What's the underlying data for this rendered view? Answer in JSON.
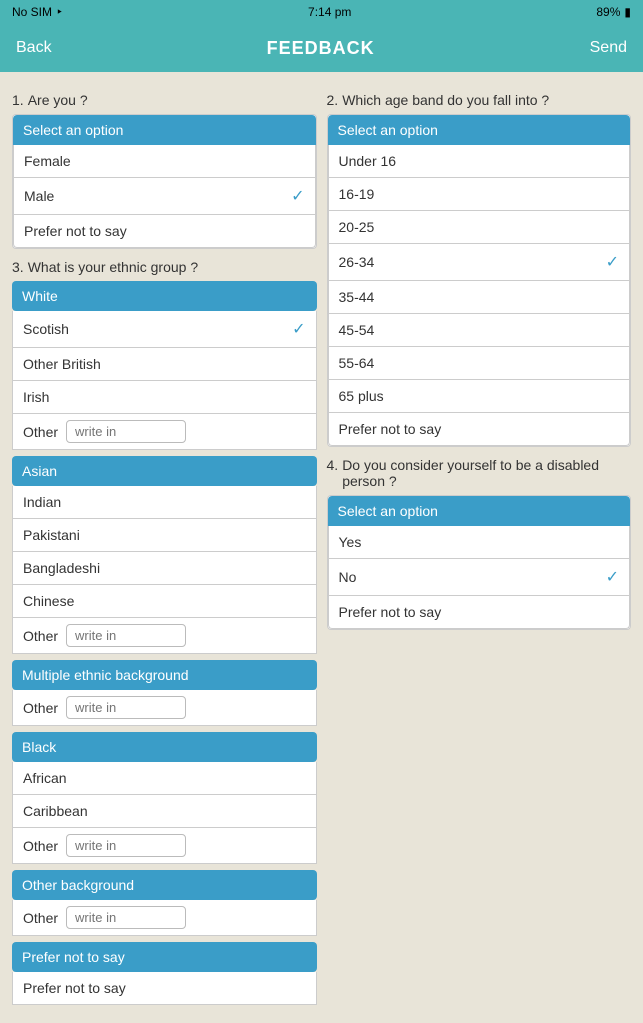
{
  "statusBar": {
    "carrier": "No SIM",
    "time": "7:14 pm",
    "battery": "89%"
  },
  "header": {
    "back": "Back",
    "title": "FEEDBACK",
    "send": "Send"
  },
  "q1": {
    "number": "1.",
    "label": "Are you ?",
    "selectLabel": "Select an option",
    "options": [
      {
        "text": "Female",
        "checked": false
      },
      {
        "text": "Male",
        "checked": true
      },
      {
        "text": "Prefer not to say",
        "checked": false
      }
    ]
  },
  "q2": {
    "number": "2.",
    "label": "Which age band do you fall into ?",
    "selectLabel": "Select an option",
    "options": [
      {
        "text": "Under 16",
        "checked": false
      },
      {
        "text": "16-19",
        "checked": false
      },
      {
        "text": "20-25",
        "checked": false
      },
      {
        "text": "26-34",
        "checked": true
      },
      {
        "text": "35-44",
        "checked": false
      },
      {
        "text": "45-54",
        "checked": false
      },
      {
        "text": "55-64",
        "checked": false
      },
      {
        "text": "65 plus",
        "checked": false
      },
      {
        "text": "Prefer not to say",
        "checked": false
      }
    ]
  },
  "q3": {
    "number": "3.",
    "label": "What is your ethnic group ?",
    "groups": [
      {
        "header": "White",
        "options": [
          {
            "text": "Scotish",
            "checked": true,
            "hasInput": false
          },
          {
            "text": "Other British",
            "checked": false,
            "hasInput": false
          },
          {
            "text": "Irish",
            "checked": false,
            "hasInput": false
          },
          {
            "text": "Other",
            "checked": false,
            "hasInput": true,
            "inputPlaceholder": "write in"
          }
        ]
      },
      {
        "header": "Asian",
        "options": [
          {
            "text": "Indian",
            "checked": false,
            "hasInput": false
          },
          {
            "text": "Pakistani",
            "checked": false,
            "hasInput": false
          },
          {
            "text": "Bangladeshi",
            "checked": false,
            "hasInput": false
          },
          {
            "text": "Chinese",
            "checked": false,
            "hasInput": false
          },
          {
            "text": "Other",
            "checked": false,
            "hasInput": true,
            "inputPlaceholder": "write in"
          }
        ]
      },
      {
        "header": "Multiple ethnic background",
        "options": [
          {
            "text": "Other",
            "checked": false,
            "hasInput": true,
            "inputPlaceholder": "write in"
          }
        ]
      },
      {
        "header": "Black",
        "options": [
          {
            "text": "African",
            "checked": false,
            "hasInput": false
          },
          {
            "text": "Caribbean",
            "checked": false,
            "hasInput": false
          },
          {
            "text": "Other",
            "checked": false,
            "hasInput": true,
            "inputPlaceholder": "write in"
          }
        ]
      },
      {
        "header": "Other background",
        "options": [
          {
            "text": "Other",
            "checked": false,
            "hasInput": true,
            "inputPlaceholder": "write in"
          }
        ]
      },
      {
        "header": "Prefer not to say",
        "options": [
          {
            "text": "Prefer not to say",
            "checked": false,
            "hasInput": false
          }
        ]
      }
    ]
  },
  "q4": {
    "number": "4.",
    "label": "Do you consider yourself to be a disabled person ?",
    "selectLabel": "Select an option",
    "options": [
      {
        "text": "Yes",
        "checked": false
      },
      {
        "text": "No",
        "checked": true
      },
      {
        "text": "Prefer not to say",
        "checked": false
      }
    ]
  }
}
